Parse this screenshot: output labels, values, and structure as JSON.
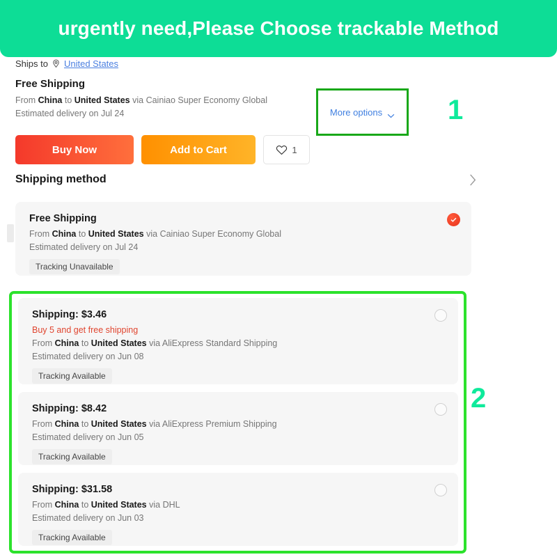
{
  "banner": {
    "text": "urgently need,Please Choose trackable Method",
    "bg_color": "#0ddd96",
    "text_color": "#ffffff"
  },
  "ships_to": {
    "label": "Ships to",
    "icon": "location-pin-icon",
    "country": "United States"
  },
  "summary": {
    "title": "Free Shipping",
    "from_prefix": "From ",
    "origin": "China",
    "to_word": " to ",
    "destination": "United States",
    "via_text": " via Cainiao Super Economy Global",
    "eta": "Estimated delivery on Jul 24"
  },
  "more_options": {
    "label": "More options",
    "icon": "chevron-down-icon",
    "border_color": "#19a819"
  },
  "markers": {
    "one": "1",
    "two": "2",
    "color": "#0fea9b"
  },
  "actions": {
    "buy_now": "Buy Now",
    "add_to_cart": "Add to Cart",
    "wishlist_icon": "heart-icon",
    "wishlist_count": "1",
    "buy_now_color": "#f4392b",
    "add_to_cart_color": "#ff9000"
  },
  "shipping_section": {
    "title": "Shipping method",
    "expand_icon": "chevron-right-icon"
  },
  "selected_option": {
    "title": "Free Shipping",
    "from_prefix": "From ",
    "origin": "China",
    "to_word": " to ",
    "destination": "United States",
    "via_text": " via Cainiao Super Economy Global",
    "eta": "Estimated delivery on Jul 24",
    "tracking": "Tracking Unavailable",
    "selected": true,
    "radio_color": "#e8341b"
  },
  "highlighted_group": {
    "border_color": "#2ce22c",
    "options": [
      {
        "title": "Shipping: $3.46",
        "promo": "Buy 5 and get free shipping",
        "from_prefix": "From ",
        "origin": "China",
        "to_word": " to ",
        "destination": "United States",
        "via_text": " via AliExpress Standard Shipping",
        "eta": "Estimated delivery on Jun 08",
        "tracking": "Tracking Available"
      },
      {
        "title": "Shipping: $8.42",
        "promo": "",
        "from_prefix": "From ",
        "origin": "China",
        "to_word": " to ",
        "destination": "United States",
        "via_text": " via AliExpress Premium Shipping",
        "eta": "Estimated delivery on Jun 05",
        "tracking": "Tracking Available"
      },
      {
        "title": "Shipping: $31.58",
        "promo": "",
        "from_prefix": "From ",
        "origin": "China",
        "to_word": " to ",
        "destination": "United States",
        "via_text": " via DHL",
        "eta": "Estimated delivery on Jun 03",
        "tracking": "Tracking Available"
      }
    ]
  }
}
